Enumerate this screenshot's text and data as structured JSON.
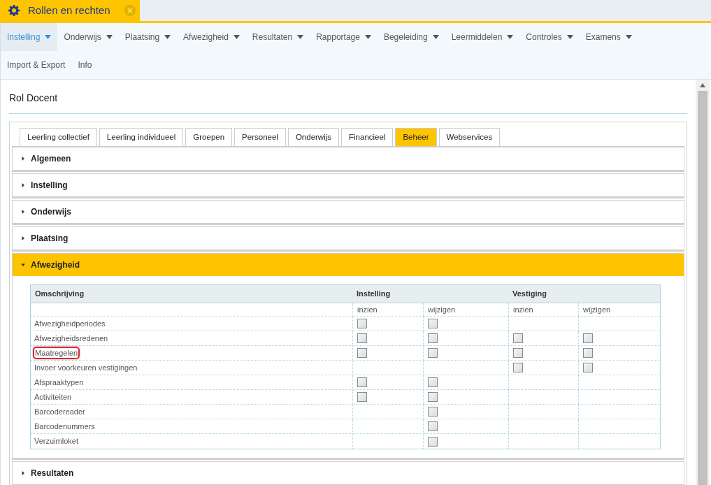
{
  "window": {
    "title": "Rollen en rechten"
  },
  "menu": [
    {
      "label": "Instelling",
      "selected": true,
      "dropdown": true
    },
    {
      "label": "Onderwijs",
      "selected": false,
      "dropdown": true
    },
    {
      "label": "Plaatsing",
      "selected": false,
      "dropdown": true
    },
    {
      "label": "Afwezigheid",
      "selected": false,
      "dropdown": true
    },
    {
      "label": "Resultaten",
      "selected": false,
      "dropdown": true
    },
    {
      "label": "Rapportage",
      "selected": false,
      "dropdown": true
    },
    {
      "label": "Begeleiding",
      "selected": false,
      "dropdown": true
    },
    {
      "label": "Leermiddelen",
      "selected": false,
      "dropdown": true
    },
    {
      "label": "Controles",
      "selected": false,
      "dropdown": true
    },
    {
      "label": "Examens",
      "selected": false,
      "dropdown": true
    },
    {
      "label": "Import & Export",
      "selected": false,
      "dropdown": false
    },
    {
      "label": "Info",
      "selected": false,
      "dropdown": false
    }
  ],
  "heading": "Rol Docent",
  "tabs": [
    {
      "label": "Leerling collectief",
      "selected": false
    },
    {
      "label": "Leerling individueel",
      "selected": false
    },
    {
      "label": "Groepen",
      "selected": false
    },
    {
      "label": "Personeel",
      "selected": false
    },
    {
      "label": "Onderwijs",
      "selected": false
    },
    {
      "label": "Financieel",
      "selected": false
    },
    {
      "label": "Beheer",
      "selected": true
    },
    {
      "label": "Webservices",
      "selected": false
    }
  ],
  "sections": [
    {
      "title": "Algemeen",
      "expanded": false
    },
    {
      "title": "Instelling",
      "expanded": false
    },
    {
      "title": "Onderwijs",
      "expanded": false
    },
    {
      "title": "Plaatsing",
      "expanded": false
    },
    {
      "title": "Afwezigheid",
      "expanded": true,
      "table": {
        "columns": [
          "Omschrijving",
          "Instelling",
          "Vestiging"
        ],
        "subcolumns": [
          "inzien",
          "wijzigen",
          "inzien",
          "wijzigen"
        ],
        "rows": [
          {
            "label": "Afwezigheidperiodes",
            "highlighted": false,
            "cells": [
              {
                "present": true,
                "checked": false
              },
              {
                "present": true,
                "checked": false
              },
              {
                "present": false
              },
              {
                "present": false
              }
            ]
          },
          {
            "label": "Afwezigheidsredenen",
            "highlighted": false,
            "cells": [
              {
                "present": true,
                "checked": false
              },
              {
                "present": true,
                "checked": false
              },
              {
                "present": true,
                "checked": false
              },
              {
                "present": true,
                "checked": false
              }
            ]
          },
          {
            "label": "Maatregelen",
            "highlighted": true,
            "cells": [
              {
                "present": true,
                "checked": false
              },
              {
                "present": true,
                "checked": false
              },
              {
                "present": true,
                "checked": false
              },
              {
                "present": true,
                "checked": false
              }
            ]
          },
          {
            "label": "Invoer voorkeuren vestigingen",
            "highlighted": false,
            "cells": [
              {
                "present": false
              },
              {
                "present": false
              },
              {
                "present": true,
                "checked": false
              },
              {
                "present": true,
                "checked": false
              }
            ]
          },
          {
            "label": "Afspraaktypen",
            "highlighted": false,
            "cells": [
              {
                "present": true,
                "checked": false
              },
              {
                "present": true,
                "checked": false
              },
              {
                "present": false
              },
              {
                "present": false
              }
            ]
          },
          {
            "label": "Activiteiten",
            "highlighted": false,
            "cells": [
              {
                "present": true,
                "checked": false
              },
              {
                "present": true,
                "checked": false
              },
              {
                "present": false
              },
              {
                "present": false
              }
            ]
          },
          {
            "label": "Barcodereader",
            "highlighted": false,
            "cells": [
              {
                "present": false
              },
              {
                "present": true,
                "checked": false
              },
              {
                "present": false
              },
              {
                "present": false
              }
            ]
          },
          {
            "label": "Barcodenummers",
            "highlighted": false,
            "cells": [
              {
                "present": false
              },
              {
                "present": true,
                "checked": false
              },
              {
                "present": false
              },
              {
                "present": false
              }
            ]
          },
          {
            "label": "Verzuimloket",
            "highlighted": false,
            "cells": [
              {
                "present": false
              },
              {
                "present": true,
                "checked": false
              },
              {
                "present": false
              },
              {
                "present": false
              }
            ]
          }
        ]
      }
    },
    {
      "title": "Resultaten",
      "expanded": false
    }
  ]
}
